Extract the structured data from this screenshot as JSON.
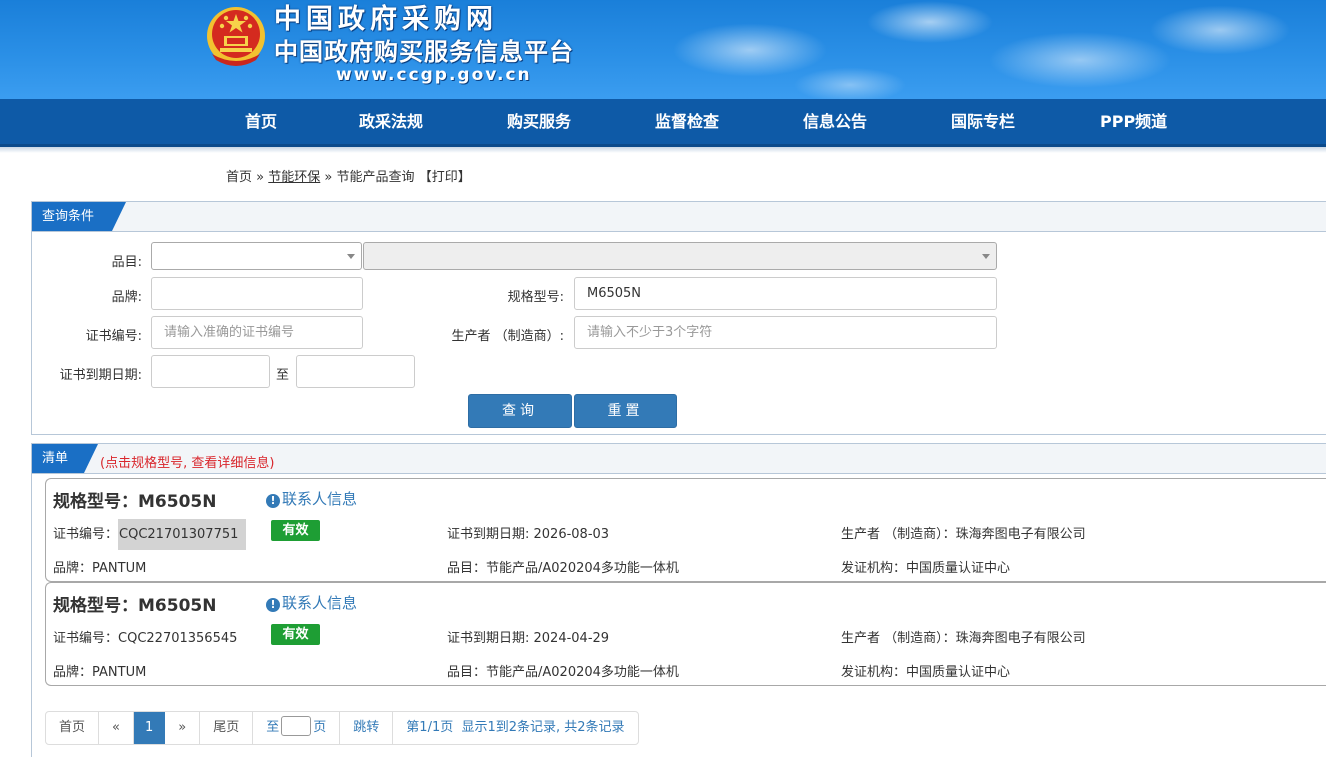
{
  "header": {
    "title": "中国政府采购网",
    "subtitle": "中国政府购买服务信息平台",
    "url": "www.ccgp.gov.cn"
  },
  "nav": [
    "首页",
    "政采法规",
    "购买服务",
    "监督检查",
    "信息公告",
    "国际专栏",
    "PPP频道"
  ],
  "breadcrumb": {
    "home": "首页",
    "sep1": "»",
    "section": "节能环保",
    "sep2": "»",
    "current": "节能产品查询",
    "print": "【打印】"
  },
  "query": {
    "tab_label": "查询条件",
    "category_label": "品目:",
    "brand_label": "品牌:",
    "brand_value": "",
    "model_label": "规格型号:",
    "model_value": "M6505N",
    "cert_label": "证书编号:",
    "cert_placeholder": "请输入准确的证书编号",
    "maker_label": "生产者 （制造商）:",
    "maker_placeholder": "请输入不少于3个字符",
    "expiry_label": "证书到期日期:",
    "to_label": "至",
    "search_button": "查询",
    "reset_button": "重置"
  },
  "list": {
    "tab_label": "清单",
    "hint": "(点击规格型号, 查看详细信息)",
    "labels": {
      "model": "规格型号：",
      "contact": "联系人信息",
      "cert_no": "证书编号：",
      "expiry": "证书到期日期: ",
      "maker": "生产者 （制造商）：",
      "brand": "品牌：",
      "category": "品目：",
      "issuer": "发证机构："
    },
    "items": [
      {
        "model": "M6505N",
        "cert_no": "CQC21701307751",
        "status": "有效",
        "expiry": "2026-08-03",
        "maker": "珠海奔图电子有限公司",
        "brand": "PANTUM",
        "category": "节能产品/A020204多功能一体机",
        "issuer": "中国质量认证中心"
      },
      {
        "model": "M6505N",
        "cert_no": "CQC22701356545",
        "status": "有效",
        "expiry": "2024-04-29",
        "maker": "珠海奔图电子有限公司",
        "brand": "PANTUM",
        "category": "节能产品/A020204多功能一体机",
        "issuer": "中国质量认证中心"
      }
    ]
  },
  "pager": {
    "first": "首页",
    "prev": "«",
    "current": "1",
    "next": "»",
    "last": "尾页",
    "goto_prefix": "至",
    "goto_suffix": "页",
    "jump": "跳转",
    "summary": "第1/1页  显示1到2条记录, 共2条记录"
  },
  "colors": {
    "header_blue": "#1a7fd9",
    "nav_blue": "#0e5aa7",
    "accent": "#337ab7",
    "valid_green": "#1e9e34",
    "hint_red": "#d9262c"
  }
}
